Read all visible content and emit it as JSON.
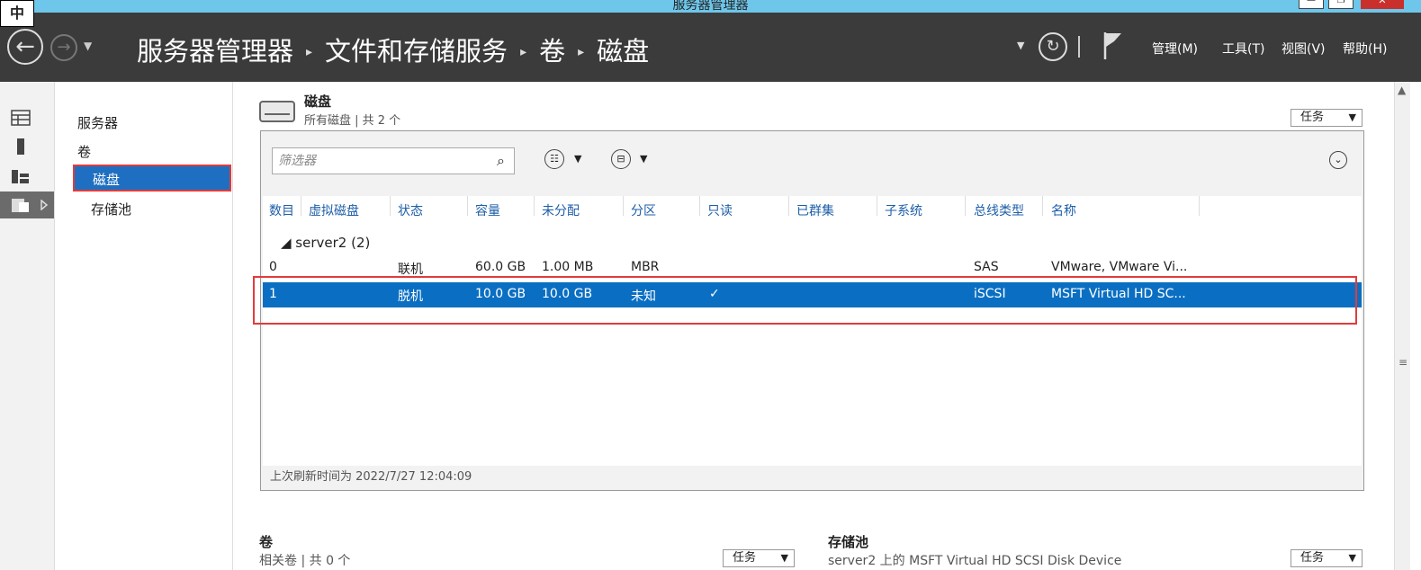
{
  "ime": "中",
  "window": {
    "title": "服务器管理器",
    "min": "—",
    "max": "❐",
    "close": "✕"
  },
  "header": {
    "back": "←",
    "forward": "→",
    "nav_dropdown": "▼",
    "breadcrumb": [
      "服务器管理器",
      "文件和存储服务",
      "卷",
      "磁盘"
    ],
    "separator": "▸",
    "dropdown": "▼",
    "refresh": "↻",
    "menus": [
      "管理(M)",
      "工具(T)",
      "视图(V)",
      "帮助(H)"
    ]
  },
  "tree": {
    "items": [
      "服务器",
      "卷",
      "磁盘",
      "存储池"
    ],
    "selected": "磁盘"
  },
  "section": {
    "title": "磁盘",
    "subtitle": "所有磁盘 | 共 2 个",
    "task_label": "任务",
    "arrow": "▼"
  },
  "toolbar": {
    "filter_placeholder": "筛选器",
    "search_glyph": "⌕",
    "view_glyph": "☷",
    "save_glyph": "⊟",
    "tri": "▼",
    "expand_glyph": "⌄"
  },
  "table": {
    "columns": [
      "数目",
      "虚拟磁盘",
      "状态",
      "容量",
      "未分配",
      "分区",
      "只读",
      "已群集",
      "子系统",
      "总线类型",
      "名称"
    ],
    "group": "◢  server2 (2)",
    "rows": [
      {
        "num": "0",
        "vdisk": "",
        "status": "联机",
        "capacity": "60.0 GB",
        "unalloc": "1.00 MB",
        "partition": "MBR",
        "readonly": "",
        "clustered": "",
        "subsystem": "",
        "bus": "SAS",
        "name": "VMware, VMware Vi..."
      },
      {
        "num": "1",
        "vdisk": "",
        "status": "脱机",
        "capacity": "10.0 GB",
        "unalloc": "10.0 GB",
        "partition": "未知",
        "readonly": "✓",
        "clustered": "",
        "subsystem": "",
        "bus": "iSCSI",
        "name": "MSFT Virtual HD SC..."
      }
    ],
    "last_refresh": "上次刷新时间为 2022/7/27 12:04:09"
  },
  "bottom": {
    "volume": {
      "title": "卷",
      "subtitle": "相关卷 | 共 0 个",
      "task_label": "任务"
    },
    "pool": {
      "title": "存储池",
      "subtitle": "server2 上的 MSFT Virtual HD SCSI Disk Device",
      "task_label": "任务"
    }
  },
  "scroll": {
    "up": "▲",
    "grip": "≡"
  },
  "colors": {
    "header": "#3b3b3b",
    "titlebar": "#6ec6ea",
    "selection": "#0a6fc2",
    "highlight_border": "#e23b3b",
    "link": "#1d5ea8"
  }
}
